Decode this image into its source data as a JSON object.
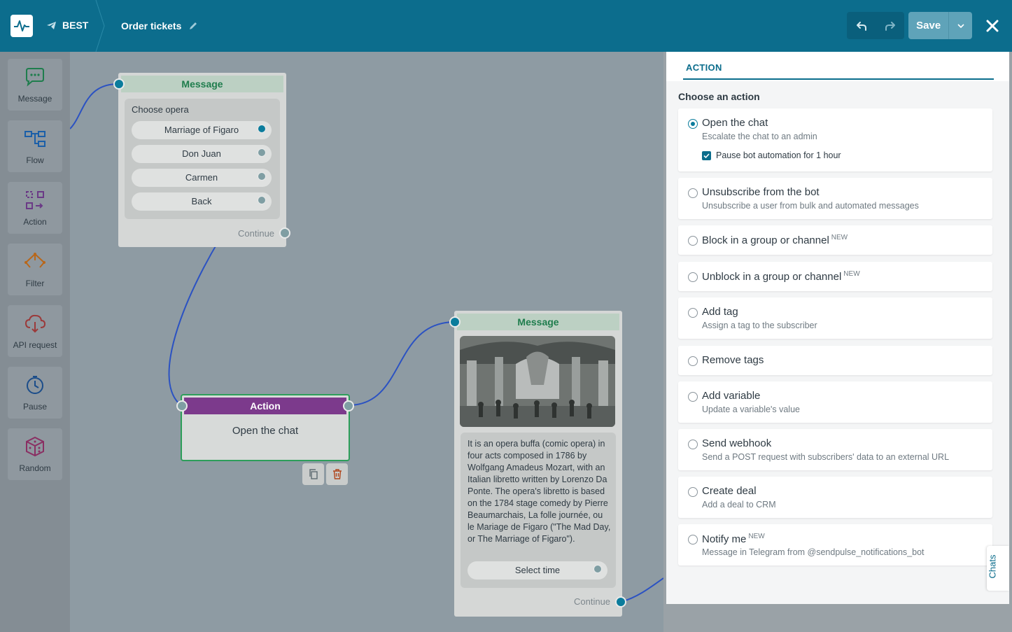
{
  "topbar": {
    "bot_name": "BEST",
    "flow_name": "Order tickets",
    "save_label": "Save"
  },
  "sidebar": {
    "items": [
      {
        "label": "Message",
        "icon": "message-icon"
      },
      {
        "label": "Flow",
        "icon": "flow-icon"
      },
      {
        "label": "Action",
        "icon": "action-icon"
      },
      {
        "label": "Filter",
        "icon": "filter-icon"
      },
      {
        "label": "API request",
        "icon": "api-request-icon"
      },
      {
        "label": "Pause",
        "icon": "pause-icon"
      },
      {
        "label": "Random",
        "icon": "random-icon"
      }
    ]
  },
  "canvas": {
    "message1": {
      "header": "Message",
      "question": "Choose opera",
      "buttons": [
        "Marriage of Figaro",
        "Don Juan",
        "Carmen",
        "Back"
      ],
      "continue": "Continue"
    },
    "action_node": {
      "header": "Action",
      "body": "Open the chat"
    },
    "message2": {
      "header": "Message",
      "text": "It is an opera buffa (comic opera) in four acts composed in 1786 by Wolfgang Amadeus Mozart, with an Italian libretto written by Lorenzo Da Ponte. The opera's libretto is based on the 1784 stage comedy by Pierre Beaumarchais, La folle journée, ou le Mariage de Figaro (\"The Mad Day, or The Marriage of Figaro\").",
      "button": "Select time",
      "continue": "Continue"
    }
  },
  "panel": {
    "tab": "ACTION",
    "title": "Choose an action",
    "options": [
      {
        "title": "Open the chat",
        "desc": "Escalate the chat to an admin",
        "selected": true
      },
      {
        "title": "Unsubscribe from the bot",
        "desc": "Unsubscribe a user from bulk and automated messages"
      },
      {
        "title": "Block in a group or channel",
        "badge": "NEW"
      },
      {
        "title": "Unblock in a group or channel",
        "badge": "NEW"
      },
      {
        "title": "Add tag",
        "desc": "Assign a tag to the subscriber"
      },
      {
        "title": "Remove tags"
      },
      {
        "title": "Add variable",
        "desc": "Update a variable's value"
      },
      {
        "title": "Send webhook",
        "desc": "Send a POST request with subscribers' data to an external URL"
      },
      {
        "title": "Create deal",
        "desc": "Add a deal to CRM"
      },
      {
        "title": "Notify me",
        "badge": "NEW",
        "desc": "Message in Telegram from @sendpulse_notifications_bot"
      }
    ],
    "pause_checkbox": {
      "label": "Pause bot automation for 1 hour",
      "checked": true
    }
  },
  "chats_tab": "Chats",
  "colors": {
    "topbar": "#0c6d8d",
    "accent": "#0b7c9c",
    "action_header": "#7c3a8c",
    "message_header": "#1f7d4d",
    "selected_border": "#2d9e5a"
  }
}
